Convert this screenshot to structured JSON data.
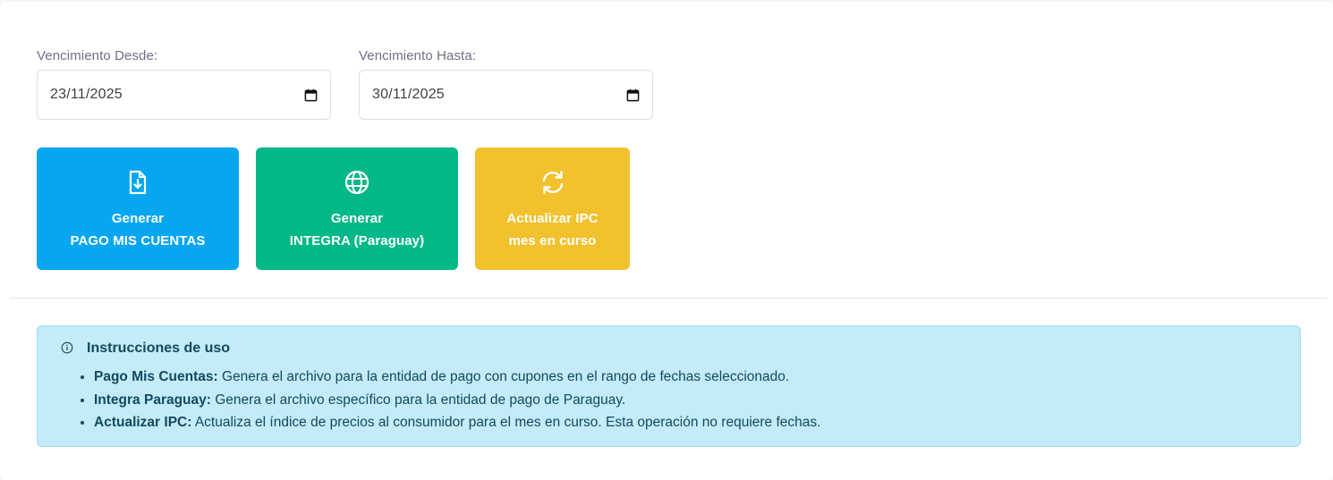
{
  "filters": {
    "desde": {
      "label": "Vencimiento Desde:",
      "value": "23/11/2025"
    },
    "hasta": {
      "label": "Vencimiento Hasta:",
      "value": "30/11/2025"
    }
  },
  "actions": [
    {
      "icon": "file-download-icon",
      "line1": "Generar",
      "line2": "PAGO MIS CUENTAS",
      "color": "#06a6f0"
    },
    {
      "icon": "globe-icon",
      "line1": "Generar",
      "line2": "INTEGRA (Paraguay)",
      "color": "#03b888"
    },
    {
      "icon": "refresh-icon",
      "line1": "Actualizar IPC",
      "line2": "mes en curso",
      "color": "#f2c12e"
    }
  ],
  "instructions": {
    "title": "Instrucciones de uso",
    "items": [
      {
        "term": "Pago Mis Cuentas:",
        "text": " Genera el archivo para la entidad de pago con cupones en el rango de fechas seleccionado."
      },
      {
        "term": "Integra Paraguay:",
        "text": " Genera el archivo específico para la entidad de pago de Paraguay."
      },
      {
        "term": "Actualizar IPC:",
        "text": " Actualiza el índice de precios al consumidor para el mes en curso. Esta operación no requiere fechas."
      }
    ]
  },
  "colors": {
    "info_bg": "#c4ebf8",
    "info_text": "#114a5c"
  }
}
